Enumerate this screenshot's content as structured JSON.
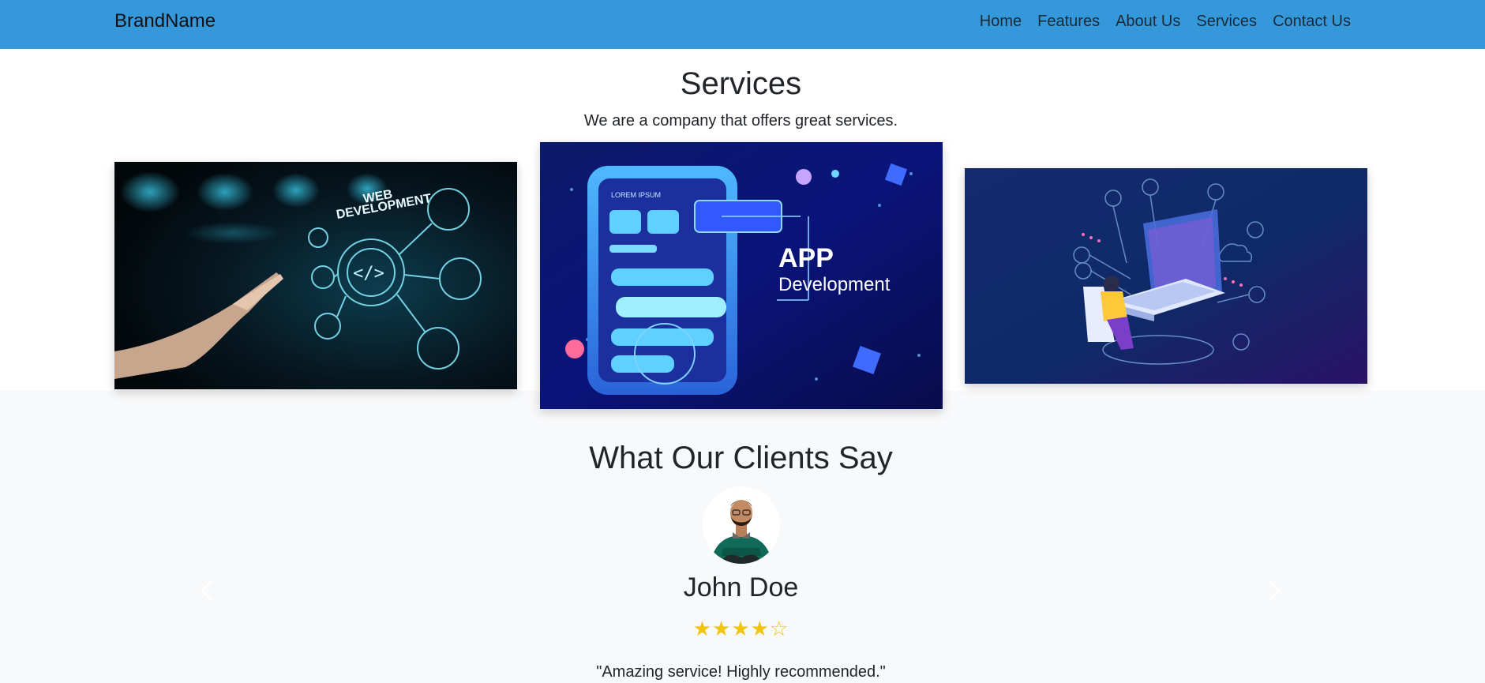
{
  "navbar": {
    "brand": "BrandName",
    "links": [
      {
        "label": "Home"
      },
      {
        "label": "Features"
      },
      {
        "label": "About Us"
      },
      {
        "label": "Services"
      },
      {
        "label": "Contact Us"
      }
    ],
    "background": "#3498db"
  },
  "services": {
    "title": "Services",
    "subtitle": "We are a company that offers great services.",
    "cards": [
      {
        "image_text_1": "WEB",
        "image_text_2": "DEVELOPMENT",
        "icon": "web-development-image"
      },
      {
        "image_text_1": "APP",
        "image_text_2": "Development",
        "screen_text": "LOREM IPSUM",
        "icon": "app-development-image"
      },
      {
        "icon": "laptop-network-image"
      }
    ]
  },
  "testimonials": {
    "title": "What Our Clients Say",
    "background": "#f8f9fa",
    "items": [
      {
        "name": "John Doe",
        "rating_text": "★★★★☆",
        "rating": 4,
        "max_rating": 5,
        "quote": "\"Amazing service! Highly recommended.\""
      }
    ],
    "prev_icon": "chevron-left-icon",
    "next_icon": "chevron-right-icon"
  },
  "colors": {
    "accent": "#3498db",
    "star": "#f1c40f",
    "text": "#212529"
  }
}
